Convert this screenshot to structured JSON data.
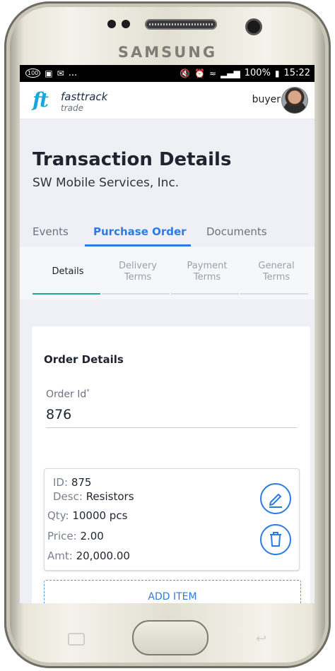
{
  "device": {
    "brand": "SAMSUNG"
  },
  "status_bar": {
    "left_icons": [
      "100",
      "image-icon",
      "mail-icon",
      "..."
    ],
    "battery": "100%",
    "time": "15:22"
  },
  "app": {
    "logo_mark": "ft",
    "logo_line1": "fasttrack",
    "logo_line2": "trade",
    "user": "buyer"
  },
  "header": {
    "title": "Transaction Details",
    "subtitle": "SW Mobile Services, Inc."
  },
  "tabs": [
    {
      "label": "Events",
      "active": false
    },
    {
      "label": "Purchase Order",
      "active": true
    },
    {
      "label": "Documents",
      "active": false
    }
  ],
  "subtabs": [
    {
      "line1": "Details",
      "line2": "",
      "active": true
    },
    {
      "line1": "Delivery",
      "line2": "Terms",
      "active": false
    },
    {
      "line1": "Payment",
      "line2": "Terms",
      "active": false
    },
    {
      "line1": "General",
      "line2": "Terms",
      "active": false
    }
  ],
  "order": {
    "section_title": "Order Details",
    "order_id_label": "Order Id",
    "required_mark": "*",
    "order_id_value": "876"
  },
  "item": {
    "id_label": "ID:",
    "id_value": "875",
    "desc_label": "Desc:",
    "desc_value": "Resistors",
    "qty_label": "Qty:",
    "qty_value": "10000 pcs",
    "price_label": "Price:",
    "price_value": "2.00",
    "amt_label": "Amt:",
    "amt_value": "20,000.00"
  },
  "add_item_label": "ADD ITEM",
  "colors": {
    "accent": "#2c7be5",
    "teal": "#26a69a",
    "header_bg": "#eef0f5"
  }
}
